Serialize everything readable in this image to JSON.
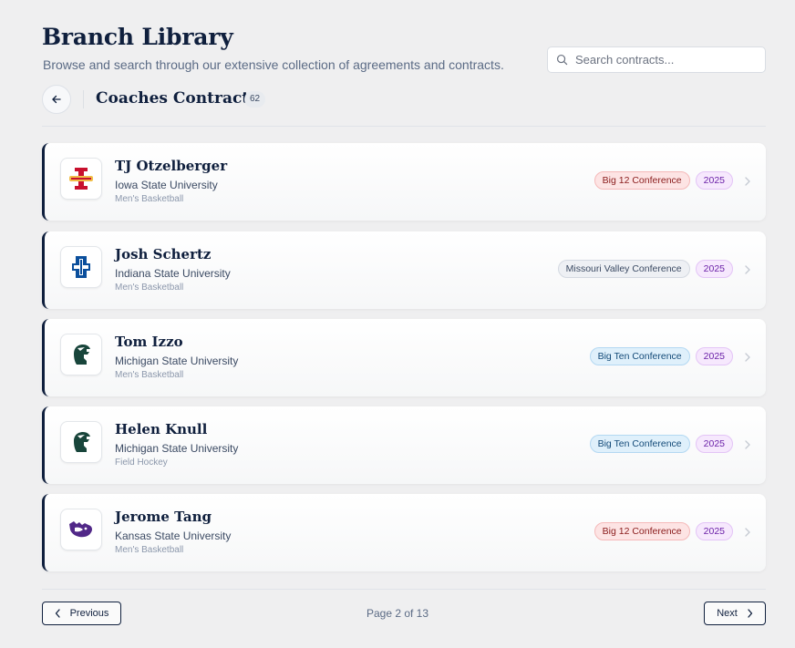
{
  "header": {
    "title": "Branch Library",
    "subtitle": "Browse and search through our extensive collection of agreements and contracts."
  },
  "search": {
    "placeholder": "Search contracts...",
    "icon": "search-icon"
  },
  "section": {
    "title": "Coaches Contracts",
    "count": "62",
    "back_icon": "arrow-left-icon"
  },
  "contracts": [
    {
      "name": "TJ Otzelberger",
      "school": "Iowa State University",
      "sport": "Men's Basketball",
      "conference": "Big 12 Conference",
      "year": "2025",
      "logo": "iowa-state-logo"
    },
    {
      "name": "Josh Schertz",
      "school": "Indiana State University",
      "sport": "Men's Basketball",
      "conference": "Missouri Valley Conference",
      "year": "2025",
      "logo": "indiana-state-logo"
    },
    {
      "name": "Tom Izzo",
      "school": "Michigan State University",
      "sport": "Men's Basketball",
      "conference": "Big Ten Conference",
      "year": "2025",
      "logo": "michigan-state-logo"
    },
    {
      "name": "Helen Knull",
      "school": "Michigan State University",
      "sport": "Field Hockey",
      "conference": "Big Ten Conference",
      "year": "2025",
      "logo": "michigan-state-logo"
    },
    {
      "name": "Jerome Tang",
      "school": "Kansas State University",
      "sport": "Men's Basketball",
      "conference": "Big 12 Conference",
      "year": "2025",
      "logo": "kansas-state-logo"
    }
  ],
  "colors": {
    "navy": "#0f1f3d",
    "big12": "#fde4e4",
    "missouri_valley": "#eef0f4",
    "big_ten": "#dff0fb",
    "year": "#f6e8fd"
  },
  "pagination": {
    "previous": "Previous",
    "next": "Next",
    "page_info": "Page 2 of 13"
  }
}
